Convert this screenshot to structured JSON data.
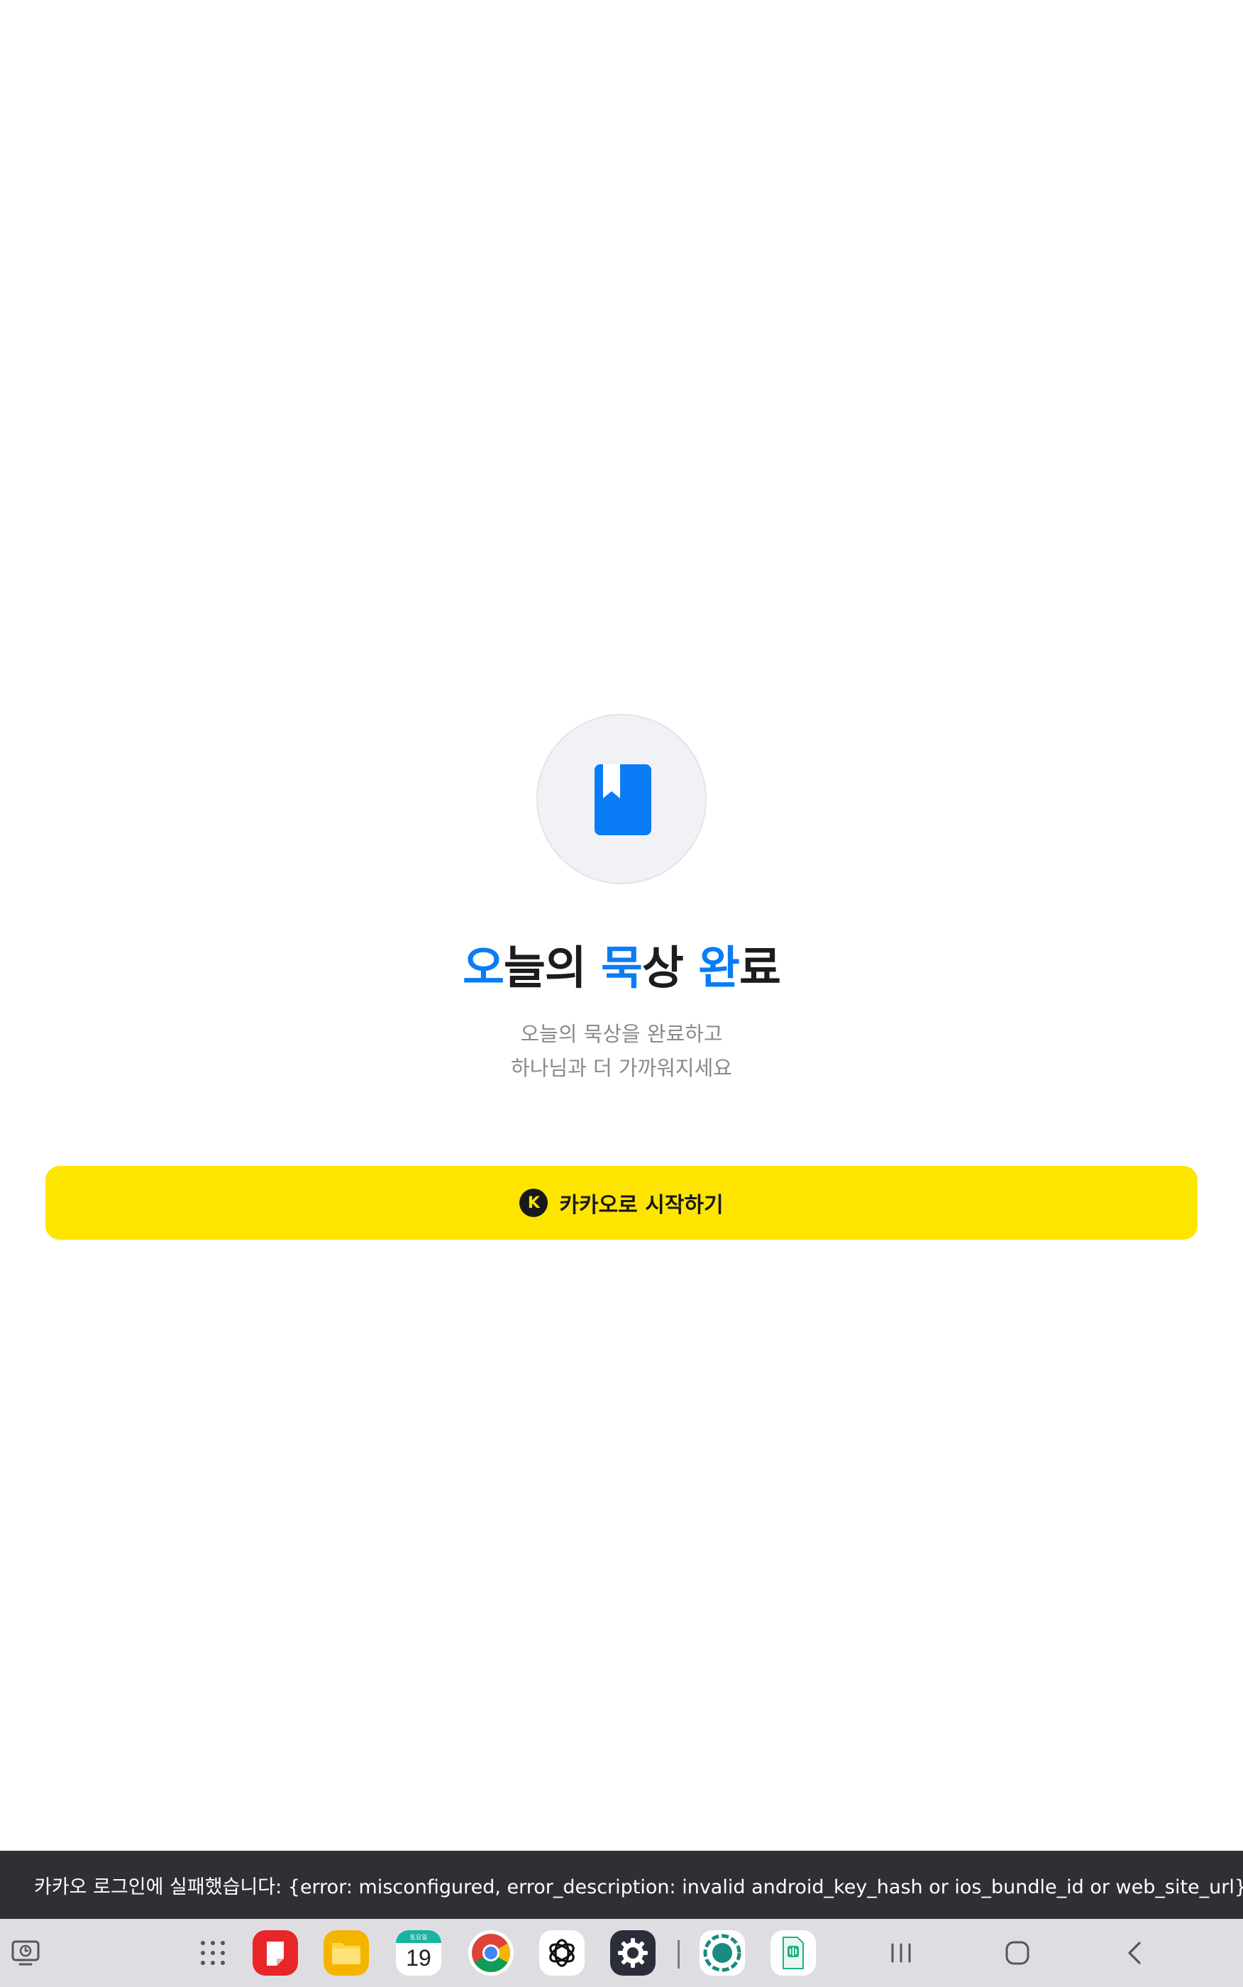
{
  "main": {
    "title_parts": [
      {
        "text": "오",
        "accent": true
      },
      {
        "text": "늘의 ",
        "accent": false
      },
      {
        "text": "묵",
        "accent": true
      },
      {
        "text": "상 ",
        "accent": false
      },
      {
        "text": "완",
        "accent": true
      },
      {
        "text": "료",
        "accent": false
      }
    ],
    "subtitle_line1": "오늘의 묵상을 완료하고",
    "subtitle_line2": "하나님과 더 가까워지세요",
    "kakao_badge": "K",
    "kakao_button_label": "카카오로 시작하기",
    "logo_icon": "book-bookmark-icon"
  },
  "snackbar": {
    "message": "카카오 로그인에 실패했습니다: {error: misconfigured, error_description: invalid android_key_hash or ios_bundle_id or web_site_url}"
  },
  "taskbar": {
    "calendar_day_label": "토요일",
    "calendar_date": "19",
    "apps": [
      "screen-time-icon",
      "app-drawer-icon",
      "notes-app-icon",
      "files-app-icon",
      "calendar-app-icon",
      "chrome-app-icon",
      "chatgpt-app-icon",
      "settings-app-icon",
      "camera-app-icon",
      "voice-recorder-app-icon"
    ],
    "nav": [
      "recent-apps-button",
      "home-button",
      "back-button"
    ]
  },
  "colors": {
    "accent": "#0a7cf5",
    "kakao_yellow": "#fee500",
    "kakao_dark": "#191919",
    "snackbar_bg": "#303034"
  }
}
